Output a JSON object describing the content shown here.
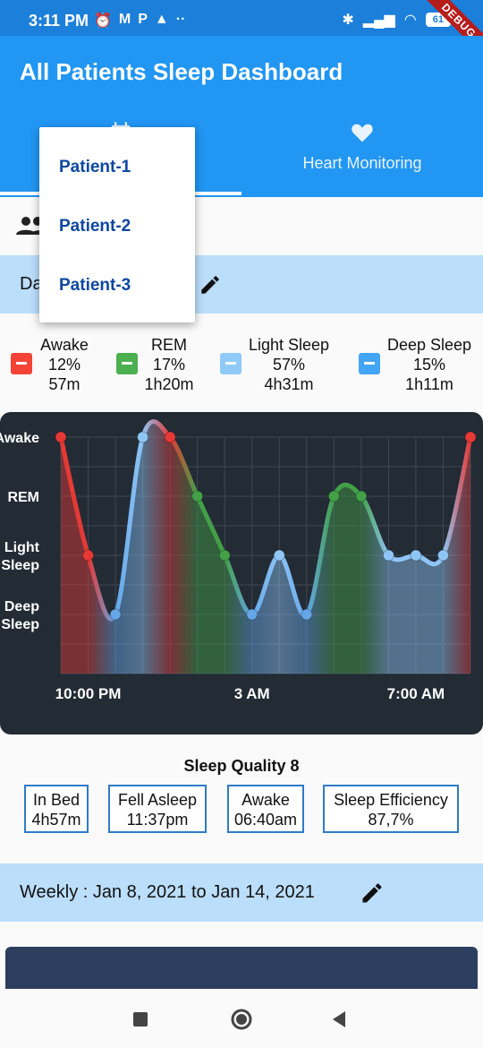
{
  "status_bar": {
    "time": "3:11 PM",
    "notif_icons": [
      "alarm-icon",
      "gmail-icon",
      "p-icon",
      "app-icon",
      "more-dots-icon"
    ],
    "battery": "61",
    "ribbon": "DEBUG"
  },
  "app": {
    "title": "All Patients Sleep Dashboard"
  },
  "tabs": [
    {
      "label": "",
      "icon": "calendar-icon",
      "selected": true
    },
    {
      "label": "Heart Monitoring",
      "icon": "heart-icon",
      "selected": false
    }
  ],
  "date_section": {
    "label_visible": "Da",
    "icon": "edit-icon"
  },
  "patients_icon": "people-icon",
  "dropdown": {
    "items": [
      "Patient-1",
      "Patient-2",
      "Patient-3"
    ]
  },
  "legend": [
    {
      "name": "Awake",
      "percent": "12%",
      "duration": "57m",
      "color": "#f44336"
    },
    {
      "name": "REM",
      "percent": "17%",
      "duration": "1h20m",
      "color": "#4caf50"
    },
    {
      "name": "Light Sleep",
      "percent": "57%",
      "duration": "4h31m",
      "color": "#90caf9"
    },
    {
      "name": "Deep Sleep",
      "percent": "15%",
      "duration": "1h11m",
      "color": "#42a5f5"
    }
  ],
  "chart_data": {
    "type": "line",
    "y_levels": [
      "Awake",
      "REM",
      "Light Sleep",
      "Deep Sleep"
    ],
    "ylabels": [
      {
        "lines": [
          "Awake"
        ],
        "level": 3
      },
      {
        "lines": [
          "REM"
        ],
        "level": 2
      },
      {
        "lines": [
          "Light",
          "Sleep"
        ],
        "level": 1
      },
      {
        "lines": [
          "Deep",
          "Sleep"
        ],
        "level": 0
      }
    ],
    "x_ticks": [
      {
        "label": "10:00 PM",
        "index": 1
      },
      {
        "label": "3 AM",
        "index": 7
      },
      {
        "label": "7:00 AM",
        "index": 13
      }
    ],
    "points": [
      {
        "stage": "Awake",
        "level": 3
      },
      {
        "stage": "Awake",
        "level": 1
      },
      {
        "stage": "Deep Sleep",
        "level": 0
      },
      {
        "stage": "Light Sleep",
        "level": 3
      },
      {
        "stage": "Awake",
        "level": 3
      },
      {
        "stage": "REM",
        "level": 2
      },
      {
        "stage": "REM",
        "level": 1
      },
      {
        "stage": "Deep Sleep",
        "level": 0
      },
      {
        "stage": "Light Sleep",
        "level": 1
      },
      {
        "stage": "Deep Sleep",
        "level": 0
      },
      {
        "stage": "REM",
        "level": 2
      },
      {
        "stage": "REM",
        "level": 2
      },
      {
        "stage": "Light Sleep",
        "level": 1
      },
      {
        "stage": "Light Sleep",
        "level": 1
      },
      {
        "stage": "Light Sleep",
        "level": 1
      },
      {
        "stage": "Awake",
        "level": 3
      }
    ],
    "colors": {
      "Awake": "#e53935",
      "REM": "#43a047",
      "Light Sleep": "#8ec5f5",
      "Deep Sleep": "#64a6e8"
    },
    "grid": true,
    "background": "#232b35"
  },
  "quality": {
    "title": "Sleep Quality 8",
    "stats": [
      {
        "label": "In Bed",
        "value": "4h57m"
      },
      {
        "label": "Fell Asleep",
        "value": "11:37pm"
      },
      {
        "label": "Awake",
        "value": "06:40am"
      },
      {
        "label": "Sleep Efficiency",
        "value": "87,7%"
      }
    ]
  },
  "weekly": {
    "label": "Weekly : Jan 8, 2021 to Jan 14, 2021",
    "icon": "edit-icon"
  },
  "nav": [
    "recent-apps-icon",
    "home-icon",
    "back-icon"
  ]
}
